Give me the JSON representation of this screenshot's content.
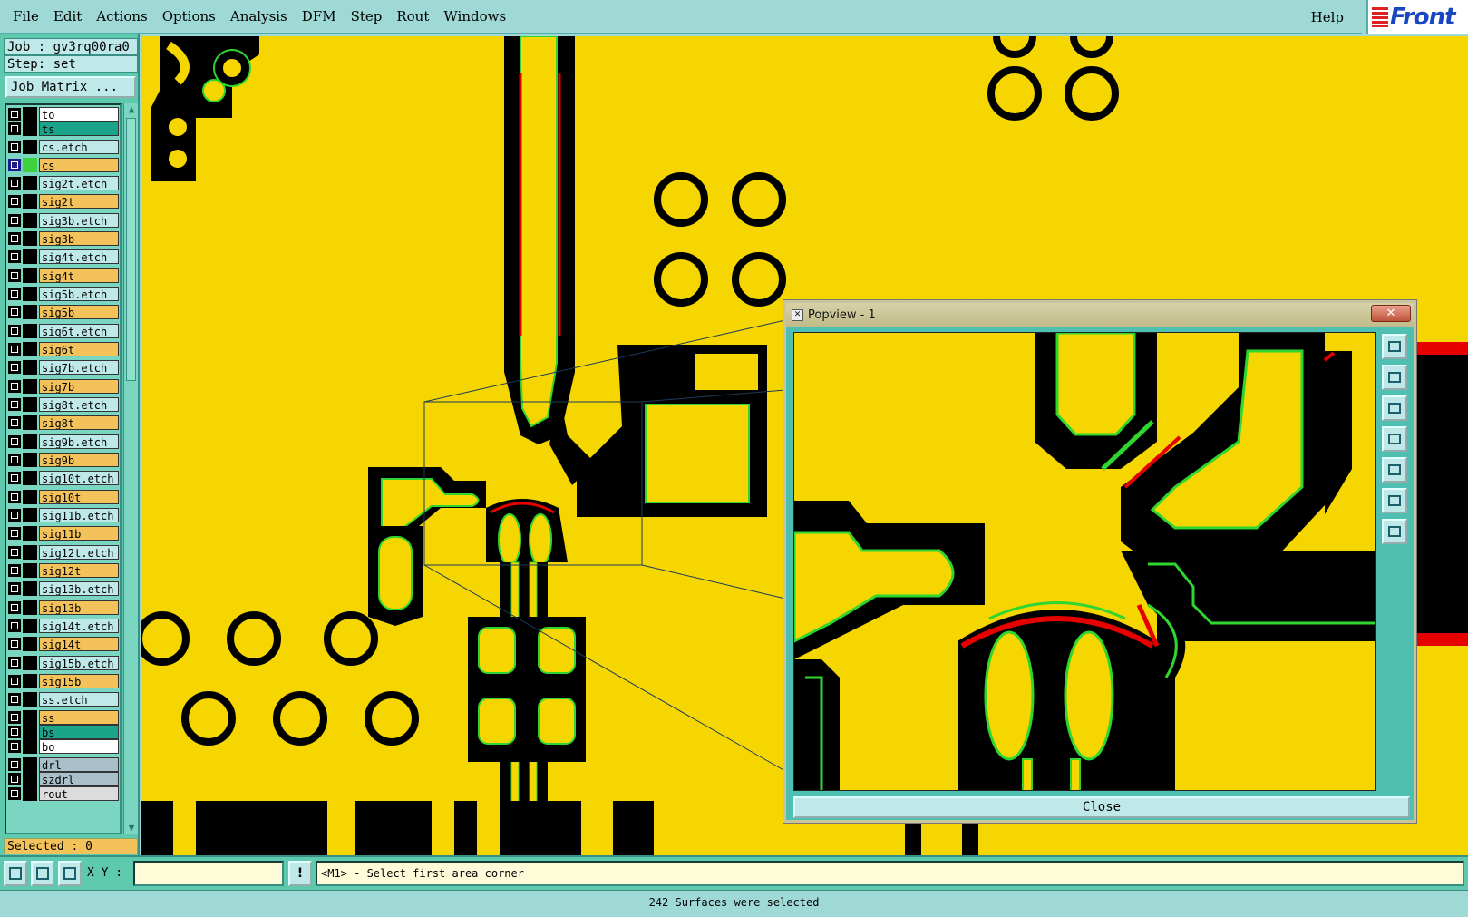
{
  "menu": {
    "items": [
      "File",
      "Edit",
      "Actions",
      "Options",
      "Analysis",
      "DFM",
      "Step",
      "Rout",
      "Windows"
    ],
    "help": "Help",
    "logo_text": "Front"
  },
  "job": {
    "job_label": "Job : gv3rq00ra0",
    "step_label": "Step: set",
    "job_matrix_button": "Job Matrix ..."
  },
  "layers": [
    {
      "name": "to",
      "color": "#ffffff",
      "active": false
    },
    {
      "name": "ts",
      "color": "#1aa58a",
      "active": false
    },
    {
      "name": "cs.etch",
      "color": "#bfe9e9",
      "active": false
    },
    {
      "name": "cs",
      "color": "#f4c25a",
      "active": true
    },
    {
      "name": "sig2t.etch",
      "color": "#bfe9e9",
      "active": false
    },
    {
      "name": "sig2t",
      "color": "#f4c25a",
      "active": false
    },
    {
      "name": "sig3b.etch",
      "color": "#bfe9e9",
      "active": false
    },
    {
      "name": "sig3b",
      "color": "#f4c25a",
      "active": false
    },
    {
      "name": "sig4t.etch",
      "color": "#bfe9e9",
      "active": false
    },
    {
      "name": "sig4t",
      "color": "#f4c25a",
      "active": false
    },
    {
      "name": "sig5b.etch",
      "color": "#bfe9e9",
      "active": false
    },
    {
      "name": "sig5b",
      "color": "#f4c25a",
      "active": false
    },
    {
      "name": "sig6t.etch",
      "color": "#bfe9e9",
      "active": false
    },
    {
      "name": "sig6t",
      "color": "#f4c25a",
      "active": false
    },
    {
      "name": "sig7b.etch",
      "color": "#bfe9e9",
      "active": false
    },
    {
      "name": "sig7b",
      "color": "#f4c25a",
      "active": false
    },
    {
      "name": "sig8t.etch",
      "color": "#bfe9e9",
      "active": false
    },
    {
      "name": "sig8t",
      "color": "#f4c25a",
      "active": false
    },
    {
      "name": "sig9b.etch",
      "color": "#bfe9e9",
      "active": false
    },
    {
      "name": "sig9b",
      "color": "#f4c25a",
      "active": false
    },
    {
      "name": "sig10t.etch",
      "color": "#bfe9e9",
      "active": false
    },
    {
      "name": "sig10t",
      "color": "#f4c25a",
      "active": false
    },
    {
      "name": "sig11b.etch",
      "color": "#bfe9e9",
      "active": false
    },
    {
      "name": "sig11b",
      "color": "#f4c25a",
      "active": false
    },
    {
      "name": "sig12t.etch",
      "color": "#bfe9e9",
      "active": false
    },
    {
      "name": "sig12t",
      "color": "#f4c25a",
      "active": false
    },
    {
      "name": "sig13b.etch",
      "color": "#bfe9e9",
      "active": false
    },
    {
      "name": "sig13b",
      "color": "#f4c25a",
      "active": false
    },
    {
      "name": "sig14t.etch",
      "color": "#bfe9e9",
      "active": false
    },
    {
      "name": "sig14t",
      "color": "#f4c25a",
      "active": false
    },
    {
      "name": "sig15b.etch",
      "color": "#bfe9e9",
      "active": false
    },
    {
      "name": "sig15b",
      "color": "#f4c25a",
      "active": false
    },
    {
      "name": "ss.etch",
      "color": "#bfe9e9",
      "active": false
    },
    {
      "name": "ss",
      "color": "#f4c25a",
      "active": false
    },
    {
      "name": "bs",
      "color": "#1aa58a",
      "active": false
    },
    {
      "name": "bo",
      "color": "#ffffff",
      "active": false
    },
    {
      "name": "drl",
      "color": "#a9bfc9",
      "active": false
    },
    {
      "name": "szdrl",
      "color": "#a9bfc9",
      "active": false
    },
    {
      "name": "rout",
      "color": "#dcdcdc",
      "active": false
    }
  ],
  "selected_label": "Selected : 0",
  "popview": {
    "title": "Popview - 1",
    "close_x": "✕",
    "close_button": "Close"
  },
  "command": {
    "xy_label": "X Y :",
    "xy_value": "",
    "warn_glyph": "!",
    "prompt_text": "<M1> - Select first area corner"
  },
  "status": {
    "text": "242 Surfaces were selected"
  },
  "colors": {
    "board": "#f5d600",
    "copper": "#000000",
    "outline_green": "#2fd62f",
    "highlight_red": "#e60000",
    "ui_teal": "#5fc9ad"
  }
}
